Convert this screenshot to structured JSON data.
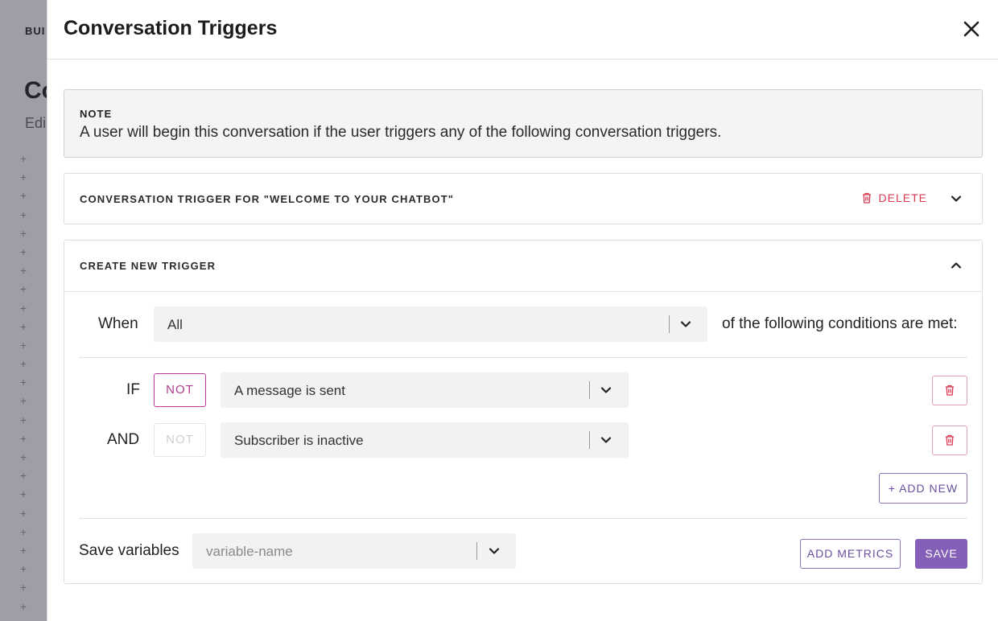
{
  "background": {
    "breadcrumb": "BUI",
    "title": "Co",
    "subtitle": "Edi"
  },
  "modal": {
    "title": "Conversation Triggers",
    "note": {
      "label": "NOTE",
      "text": "A user will begin this conversation if the user triggers any of the following conversation triggers."
    },
    "existing_trigger": {
      "title": "CONVERSATION TRIGGER FOR \"WELCOME TO YOUR CHATBOT\"",
      "delete_label": "DELETE"
    },
    "new_trigger": {
      "title": "CREATE NEW TRIGGER",
      "when_label": "When",
      "when_value": "All",
      "when_suffix": "of the following conditions are met:",
      "conditions": [
        {
          "connector": "IF",
          "not_label": "NOT",
          "not_active": true,
          "value": "A message is sent"
        },
        {
          "connector": "AND",
          "not_label": "NOT",
          "not_active": false,
          "value": "Subscriber is inactive"
        }
      ],
      "add_new_label": "+ ADD NEW",
      "save_variables_label": "Save variables",
      "variable_placeholder": "variable-name",
      "add_metrics_label": "ADD METRICS",
      "save_label": "SAVE"
    }
  },
  "colors": {
    "accent": "#8560b8",
    "delete": "#d83a52",
    "not_active": "#c0399a"
  }
}
